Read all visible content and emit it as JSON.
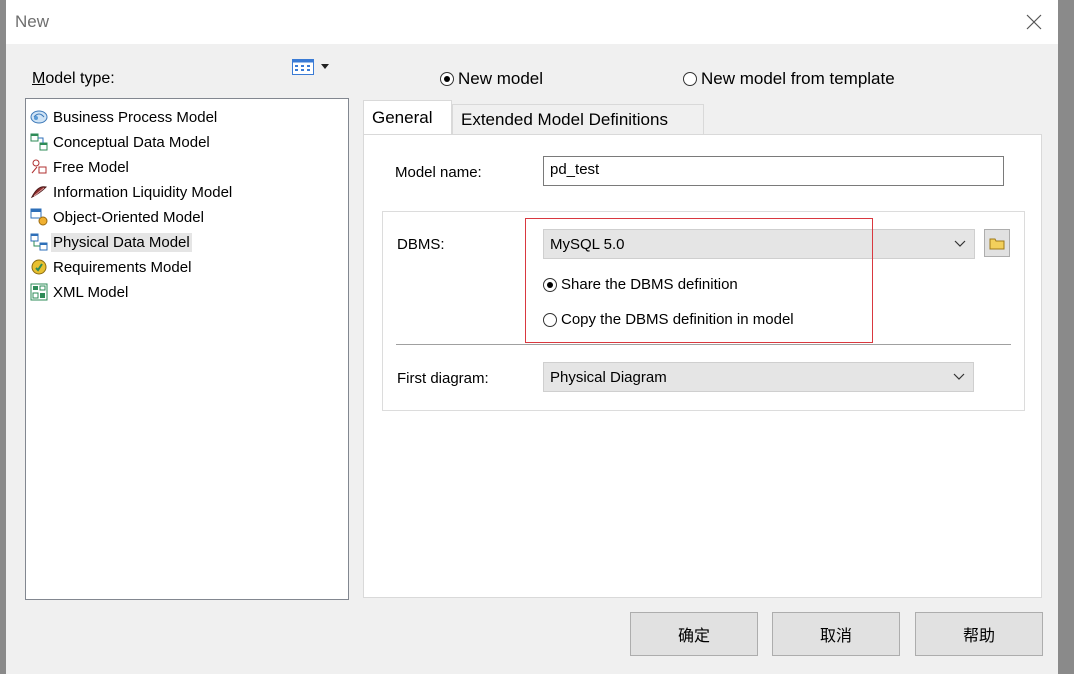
{
  "window": {
    "title": "New"
  },
  "left": {
    "model_type_label": "Model type:",
    "model_types": [
      {
        "label": "Business Process Model",
        "icon": "business-process-icon"
      },
      {
        "label": "Conceptual Data Model",
        "icon": "conceptual-data-icon"
      },
      {
        "label": "Free Model",
        "icon": "free-model-icon"
      },
      {
        "label": "Information Liquidity Model",
        "icon": "information-liquidity-icon"
      },
      {
        "label": "Object-Oriented Model",
        "icon": "object-oriented-icon"
      },
      {
        "label": "Physical Data Model",
        "icon": "physical-data-icon",
        "selected": true
      },
      {
        "label": "Requirements Model",
        "icon": "requirements-icon"
      },
      {
        "label": "XML Model",
        "icon": "xml-model-icon"
      }
    ]
  },
  "mode": {
    "new_model": "New model",
    "from_template": "New model from template",
    "selected": "new_model"
  },
  "tabs": [
    {
      "label": "General",
      "active": true
    },
    {
      "label": "Extended Model Definitions"
    }
  ],
  "general": {
    "model_name_label": "Model name:",
    "model_name_value": "pd_test",
    "dbms_label": "DBMS:",
    "dbms_value": "MySQL 5.0",
    "share_dbms": "Share the DBMS definition",
    "copy_dbms": "Copy the DBMS definition in model",
    "dbms_option_selected": "share",
    "first_diagram_label": "First diagram:",
    "first_diagram_value": "Physical Diagram"
  },
  "buttons": {
    "ok": "确定",
    "cancel": "取消",
    "help": "帮助"
  },
  "colors": {
    "highlight_box": "#d9383f",
    "selected_item": "#e5e5e5"
  }
}
